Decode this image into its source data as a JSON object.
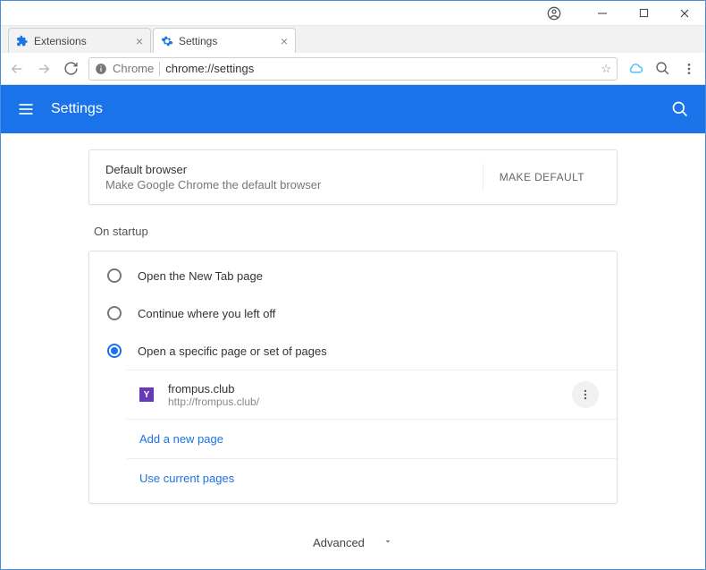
{
  "window": {
    "tabs": [
      {
        "label": "Extensions",
        "active": false
      },
      {
        "label": "Settings",
        "active": true
      }
    ]
  },
  "addressbar": {
    "security_label": "Chrome",
    "url": "chrome://settings"
  },
  "header": {
    "title": "Settings"
  },
  "default_browser": {
    "title": "Default browser",
    "subtitle": "Make Google Chrome the default browser",
    "button": "MAKE DEFAULT"
  },
  "startup": {
    "section_label": "On startup",
    "options": [
      {
        "label": "Open the New Tab page",
        "checked": false
      },
      {
        "label": "Continue where you left off",
        "checked": false
      },
      {
        "label": "Open a specific page or set of pages",
        "checked": true
      }
    ],
    "pages": [
      {
        "title": "frompus.club",
        "url": "http://frompus.club/",
        "favicon_letter": "Y"
      }
    ],
    "add_page": "Add a new page",
    "use_current": "Use current pages"
  },
  "advanced_label": "Advanced"
}
